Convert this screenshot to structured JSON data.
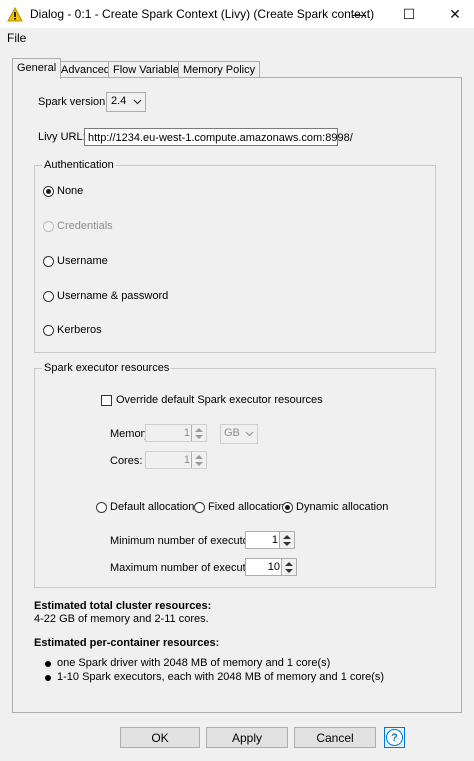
{
  "window": {
    "title": "Dialog - 0:1 - Create Spark Context (Livy) (Create Spark context)",
    "minimize_glyph": "—",
    "maximize_glyph": "☐",
    "close_glyph": "✕"
  },
  "menu": {
    "file": "File"
  },
  "tabs": [
    {
      "label": "General",
      "active": true
    },
    {
      "label": "Advanced"
    },
    {
      "label": "Flow Variables"
    },
    {
      "label": "Memory Policy"
    }
  ],
  "general": {
    "spark_version_label": "Spark version:",
    "spark_version_value": "2.4",
    "livy_url_label": "Livy URL:",
    "livy_url_value": "http://1234.eu-west-1.compute.amazonaws.com:8998/"
  },
  "authentication": {
    "legend": "Authentication",
    "options": [
      "None",
      "Credentials",
      "Username",
      "Username & password",
      "Kerberos"
    ],
    "selected": "None"
  },
  "executor": {
    "legend": "Spark executor resources",
    "override_label": "Override default Spark executor resources",
    "memory_label": "Memory:",
    "memory_value": "1",
    "memory_unit": "GB",
    "cores_label": "Cores:",
    "cores_value": "1",
    "allocation_options": [
      "Default allocation",
      "Fixed allocation",
      "Dynamic allocation"
    ],
    "allocation_selected": "Dynamic allocation",
    "min_executors_label": "Minimum number of executors:",
    "min_executors_value": "1",
    "max_executors_label": "Maximum number of executors:",
    "max_executors_value": "10"
  },
  "estimates": {
    "cluster_heading": "Estimated total cluster resources:",
    "cluster_text": "4-22 GB of memory and 2-11 cores.",
    "container_heading": "Estimated per-container resources:",
    "container_items": [
      "one Spark driver with 2048 MB of memory and 1 core(s)",
      "1-10 Spark executors, each with 2048 MB of memory and 1 core(s)"
    ]
  },
  "buttons": {
    "ok": "OK",
    "apply": "Apply",
    "cancel": "Cancel",
    "help": "?"
  },
  "colors": {
    "accent": "#0078d7",
    "warning": "#f2c200"
  }
}
